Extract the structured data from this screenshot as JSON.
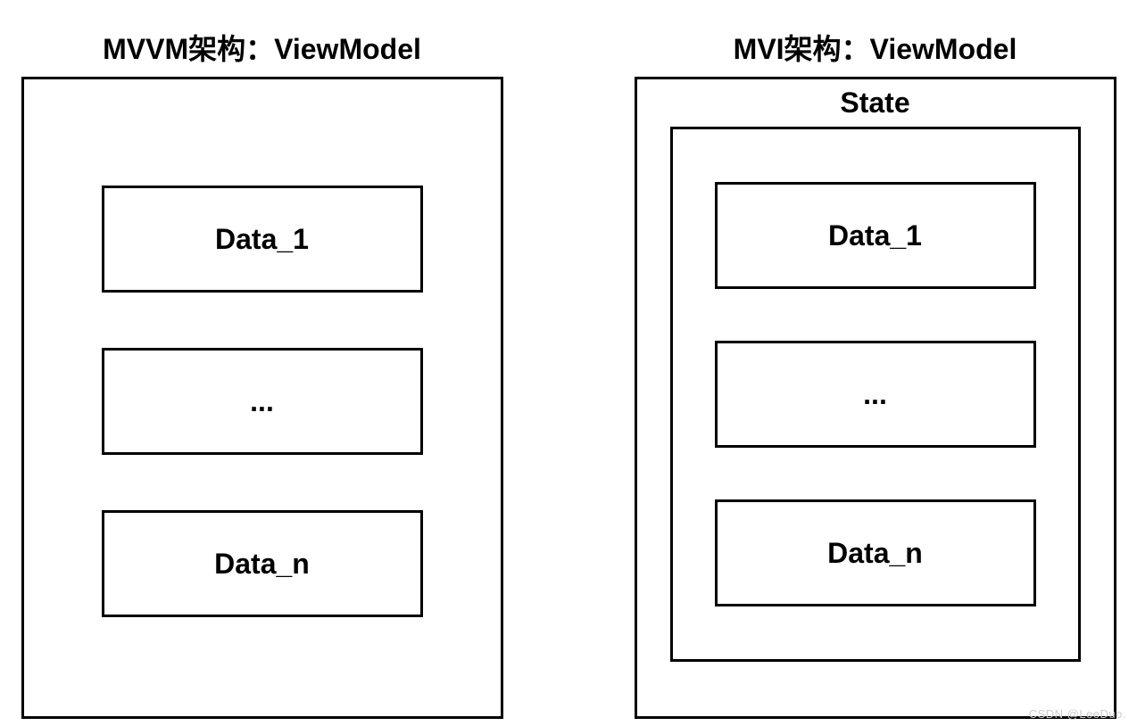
{
  "left": {
    "title": "MVVM架构：ViewModel",
    "items": [
      "Data_1",
      "...",
      "Data_n"
    ]
  },
  "right": {
    "title": "MVI架构：ViewModel",
    "state_label": "State",
    "items": [
      "Data_1",
      "...",
      "Data_n"
    ]
  },
  "watermark": "CSDN @LeeDuo."
}
